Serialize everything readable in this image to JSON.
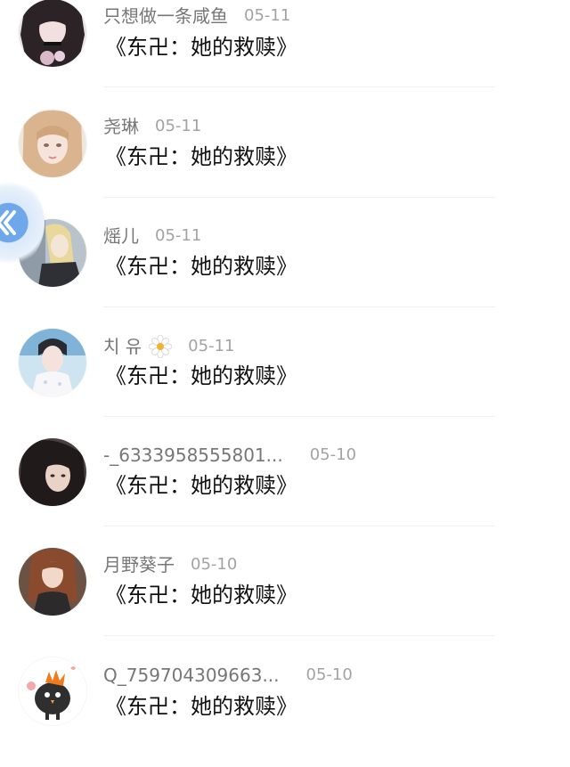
{
  "comments": [
    {
      "username": "只想做一条咸鱼",
      "date": "05-11",
      "text": "《东卍：她的救赎》",
      "avatar": "avatar-gothic-girl"
    },
    {
      "username": "尧琳",
      "date": "05-11",
      "text": "《东卍：她的救赎》",
      "avatar": "avatar-blonde-girl"
    },
    {
      "username": "熎儿",
      "date": "05-11",
      "text": "《东卍：她的救赎》",
      "avatar": "avatar-anime-blonde-boy"
    },
    {
      "username": "치 유",
      "date": "05-11",
      "text": "《东卍：她的救赎》",
      "avatar": "avatar-idol-boy",
      "badge": "flower-emoji"
    },
    {
      "username": "-_6333958555801...",
      "date": "05-10",
      "text": "《东卍：她的救赎》",
      "avatar": "avatar-dark-hair-girl"
    },
    {
      "username": "月野葵子",
      "date": "05-10",
      "text": "《东卍：她的救赎》",
      "avatar": "avatar-brown-hair-girl"
    },
    {
      "username": "Q_759704309663...",
      "date": "05-10",
      "text": "《东卍：她的救赎》",
      "avatar": "avatar-cartoon-bird"
    }
  ],
  "floating_button": {
    "icon": "collapse-arrow-icon"
  },
  "colors": {
    "username": "#777777",
    "date": "#a3a3a3",
    "text": "#111111",
    "divider": "#f1f1f1",
    "accent": "#6fa8ea"
  }
}
